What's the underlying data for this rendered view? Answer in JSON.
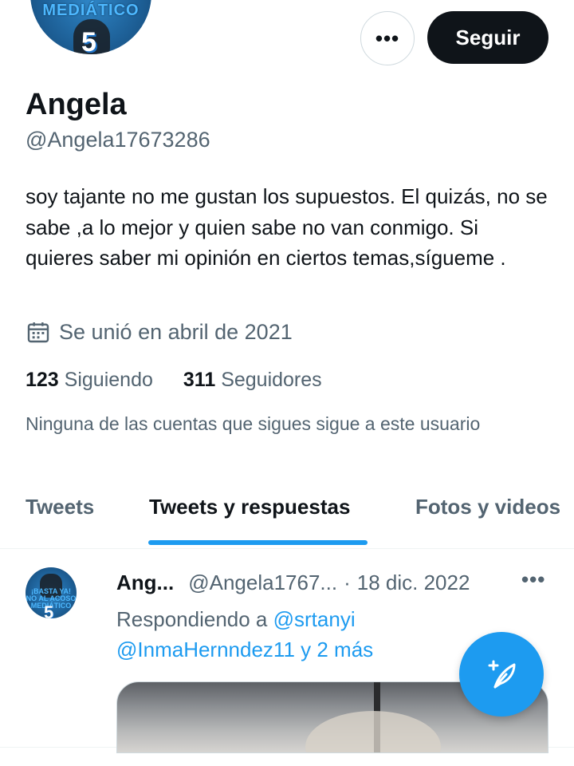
{
  "profile": {
    "avatar_text": "MEDIÁTICO",
    "avatar_badge": "5",
    "more_icon": "more-dots-icon",
    "follow_label": "Seguir",
    "name": "Angela",
    "handle": "@Angela17673286",
    "bio": "soy tajante no me gustan los supuestos. El quizás, no se sabe ,a lo mejor y quien sabe no van conmigo. Si quieres saber mi opinión en ciertos temas,sígueme .",
    "joined_icon": "calendar-icon",
    "joined": "Se unió en abril de 2021",
    "following_count": "123",
    "following_label": "Siguiendo",
    "followers_count": "311",
    "followers_label": "Seguidores",
    "no_common_followers": "Ninguna de las cuentas que sigues sigue a este usuario"
  },
  "tabs": [
    {
      "label": "Tweets",
      "active": false
    },
    {
      "label": "Tweets y respuestas",
      "active": true
    },
    {
      "label": "Fotos y videos",
      "active": false
    }
  ],
  "tweet": {
    "avatar_text": "¡BASTA YA! NO AL ACOSO MEDIÁTICO",
    "avatar_badge": "5",
    "name": "Ang...",
    "handle": "@Angela1767...",
    "separator": "·",
    "date": "18 dic. 2022",
    "more_icon": "more-dots-icon",
    "replying_prefix": "Respondiendo a",
    "mention_1": "@srtanyi",
    "mention_2": "@InmaHernndez11 y 2 más"
  },
  "fab": {
    "icon": "compose-tweet-icon"
  },
  "colors": {
    "accent": "#1d9bf0",
    "text_primary": "#0f1419",
    "text_secondary": "#536471",
    "follow_button_bg": "#0f1419"
  }
}
